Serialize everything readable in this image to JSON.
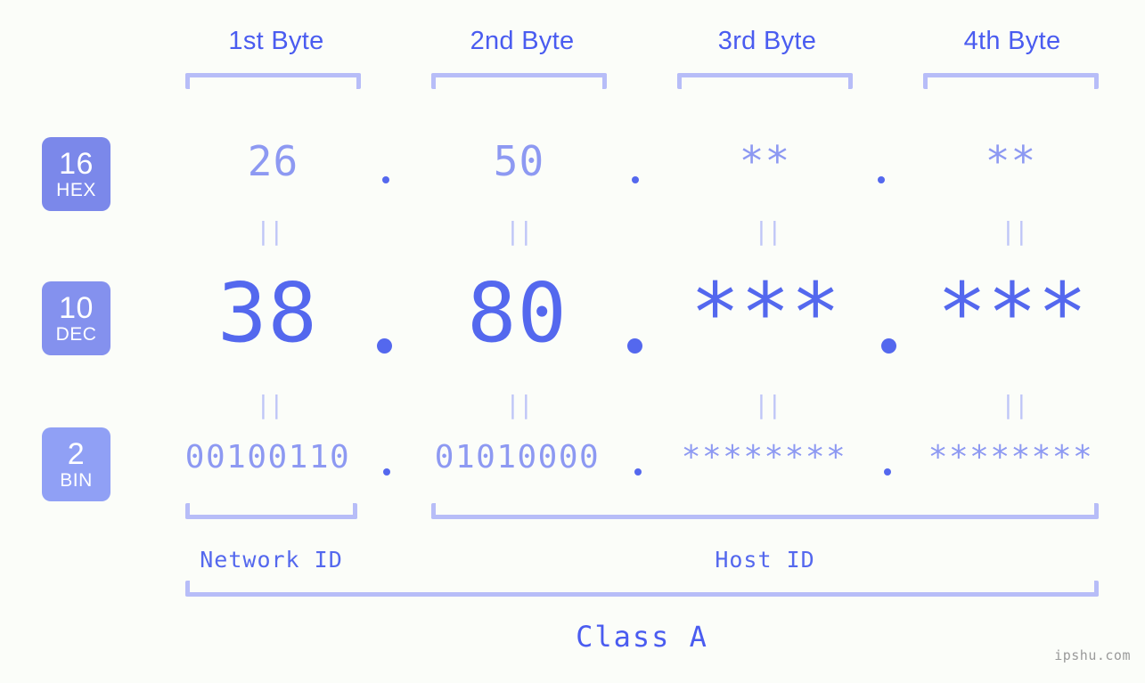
{
  "meta": {
    "background": "#fbfdf9",
    "accent_strong": "#5468ee",
    "accent_mid": "#8d99f2",
    "accent_light": "#b7bdf8",
    "badge_white": "#ffffff",
    "watermark": "ipshu.com"
  },
  "header": {
    "byte_labels": [
      "1st Byte",
      "2nd Byte",
      "3rd Byte",
      "4th Byte"
    ]
  },
  "radix_badges": [
    {
      "number": "16",
      "name": "HEX",
      "color": "#7b88ea"
    },
    {
      "number": "10",
      "name": "DEC",
      "color": "#8491ee"
    },
    {
      "number": "2",
      "name": "BIN",
      "color": "#90a0f5"
    }
  ],
  "rows": {
    "hex": {
      "label": "HEX",
      "values": [
        "26",
        "50",
        "**",
        "**"
      ]
    },
    "dec": {
      "label": "DEC",
      "values": [
        "38",
        "80",
        "***",
        "***"
      ]
    },
    "bin": {
      "label": "BIN",
      "values": [
        "00100110",
        "01010000",
        "********",
        "********"
      ]
    }
  },
  "separators": {
    "dot": ".",
    "equality": "||"
  },
  "footer": {
    "network_id_label": "Network ID",
    "host_id_label": "Host ID",
    "class_label": "Class A"
  }
}
